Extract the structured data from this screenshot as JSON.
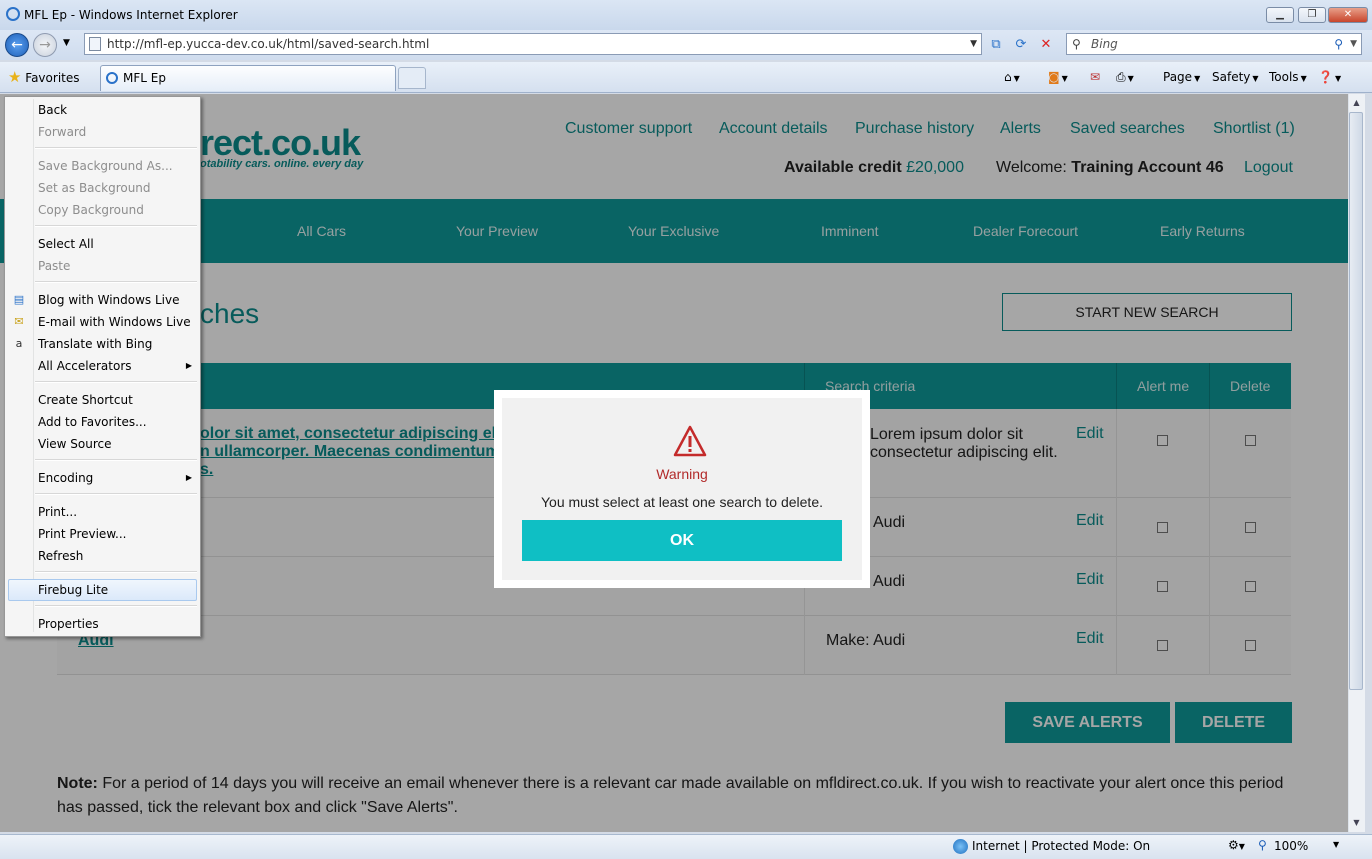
{
  "browser": {
    "window_title": "MFL Ep - Windows Internet Explorer",
    "url": "http://mfl-ep.yucca-dev.co.uk/html/saved-search.html",
    "search_placeholder": "Bing",
    "favorites_label": "Favorites",
    "tab_title": "MFL Ep",
    "commands": {
      "page": "Page",
      "safety": "Safety",
      "tools": "Tools"
    },
    "status": {
      "zone": "Internet | Protected Mode: On",
      "zoom": "100%"
    }
  },
  "site": {
    "logo_text": "rect.co.uk",
    "logo_tagline": "otability cars. online. every day",
    "top_links": [
      "Customer support",
      "Account details",
      "Purchase history",
      "Alerts",
      "Saved searches",
      "Shortlist (1)"
    ],
    "credit_label": "Available credit",
    "credit_value": "£20,000",
    "welcome_label": "Welcome:",
    "account_name": "Training Account 46",
    "logout": "Logout",
    "nav": [
      "All Cars",
      "Your Preview",
      "Your Exclusive",
      "Imminent",
      "Dealer Forecourt",
      "Early Returns"
    ]
  },
  "main": {
    "title": "ches",
    "start_new_search": "START NEW SEARCH",
    "table": {
      "headers": {
        "criteria": "Search criteria",
        "alert": "Alert me",
        "delete": "Delete"
      },
      "rows": [
        {
          "name_line1": "olor sit amet, consectetur adipiscing elit",
          "name_line2": "n ullamcorper. Maecenas condimentum",
          "name_line3": "s.",
          "criteria_line1": "Lorem ipsum dolor sit",
          "criteria_line2": "consectetur adipiscing elit.",
          "edit": "Edit"
        },
        {
          "name": "",
          "criteria": "Audi",
          "edit": "Edit"
        },
        {
          "name": "",
          "criteria": "Audi",
          "edit": "Edit"
        },
        {
          "name": "Audi",
          "criteria": "Make: Audi",
          "edit": "Edit"
        }
      ]
    },
    "save_alerts": "SAVE ALERTS",
    "delete": "DELETE",
    "note_label": "Note:",
    "note_text": " For a period of 14 days you will receive an email whenever there is a relevant car made available on mfldirect.co.uk. If you wish to reactivate your alert once this period has passed, tick the relevant box and click \"Save Alerts\"."
  },
  "dialog": {
    "title": "Warning",
    "message": "You must select at least one search to delete.",
    "ok": "OK"
  },
  "context_menu": {
    "back": "Back",
    "forward": "Forward",
    "save_background": "Save Background As...",
    "set_background": "Set as Background",
    "copy_background": "Copy Background",
    "select_all": "Select All",
    "paste": "Paste",
    "blog": "Blog with Windows Live",
    "email": "E-mail with Windows Live",
    "translate": "Translate with Bing",
    "accelerators": "All Accelerators",
    "create_shortcut": "Create Shortcut",
    "add_favorites": "Add to Favorites...",
    "view_source": "View Source",
    "encoding": "Encoding",
    "print": "Print...",
    "print_preview": "Print Preview...",
    "refresh": "Refresh",
    "firebug": "Firebug Lite",
    "properties": "Properties"
  }
}
